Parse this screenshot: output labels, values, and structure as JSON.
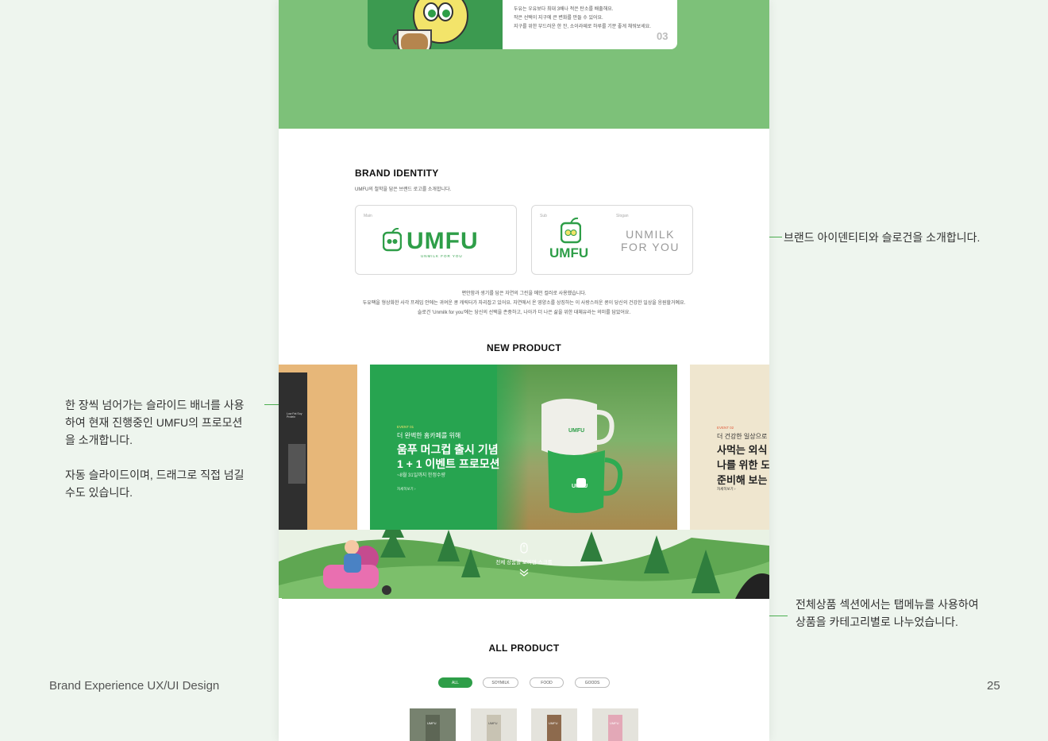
{
  "presentation": {
    "footer_left": "Brand Experience UX/UI Design",
    "page_number": "25",
    "annotations": {
      "brand_identity": "브랜드 아이덴티티와 슬로건을 소개합니다.",
      "slider_line1": "한 장씩 넘어가는 슬라이드 배너를 사용",
      "slider_line2": "하여 현재 진행중인 UMFU의 프로모션",
      "slider_line3": "을 소개합니다.",
      "slider_line4": "자동 슬라이드이며, 드래그로 직접 넘길",
      "slider_line5": "수도 있습니다.",
      "all_product_line1": "전체상품 섹션에서는 탭메뉴를  사용하여",
      "all_product_line2": "상품을 카테고리별로  나누었습니다."
    },
    "accent_color": "#2e9e48"
  },
  "top_card": {
    "line1": "두유는 우유보다 최대 3배나 적은 탄소를 배출해요.",
    "line2": "작은 선택이 지구에 큰 변화를 만들 수 있어요.",
    "line3": "지구를 위한 부드러운 한 잔, 소이라떼로 하루를 기분 좋게 채워보세요.",
    "number": "03"
  },
  "brand_identity": {
    "title": "BRAND IDENTITY",
    "subtitle": "UMFU의 철학을 담은 브랜드 로고를 소개합니다.",
    "main_label": "Main",
    "sub_label": "Sub",
    "slogan_label": "Slogan",
    "logo_text": "UMFU",
    "logo_tagline": "UNMILK FOR YOU",
    "slogan_line1": "UNMILK",
    "slogan_line2": "FOR YOU",
    "desc1": "편안함과 생기를 담은 자연의 그린을 메인 컬러로 사용했습니다.",
    "desc2": "두유팩을 형상화한 사각 프레임 안에는 귀여운 콩 캐릭터가 자리잡고 있어요. 자연에서 온 영양소를 상징하는 이 사랑스러운 콩이 당신의 건강한 일상을 응원할거예요.",
    "desc3": "슬로건 'Unmilk for you'에는 당신의 선택을 존중하고, 나아가 더 나은 삶을 위한 대체유라는 의미를 담았어요."
  },
  "new_product": {
    "title": "NEW PRODUCT",
    "main_slide": {
      "event": "EVENT 01",
      "kicker": "더 완벽한 홈카페를 위해",
      "headline1": "움푸 머그컵 출시 기념",
      "headline2": "1 + 1 이벤트 프로모션",
      "date": "~8월 31일까지 한정수량",
      "more": "자세히보기 ›",
      "mug_text": "UMFU"
    },
    "right_slide": {
      "event": "EVENT 02",
      "kicker": "더 건강한 일상으로",
      "headline1": "사먹는 외식",
      "headline2": "나를 위한 도",
      "headline3": "준비해 보는",
      "more": "자세히보기 ›"
    },
    "left_slide": {
      "pack_text": "Low Fat Soy Protein"
    },
    "scroll_hint": "전체 상품을 보려면 스크롤",
    "dots": [
      true,
      false,
      false,
      false
    ]
  },
  "all_product": {
    "title": "ALL PRODUCT",
    "tabs": [
      "ALL",
      "SOYMILK",
      "FOOD",
      "GOODS"
    ],
    "thumb_label": "UMFU"
  }
}
